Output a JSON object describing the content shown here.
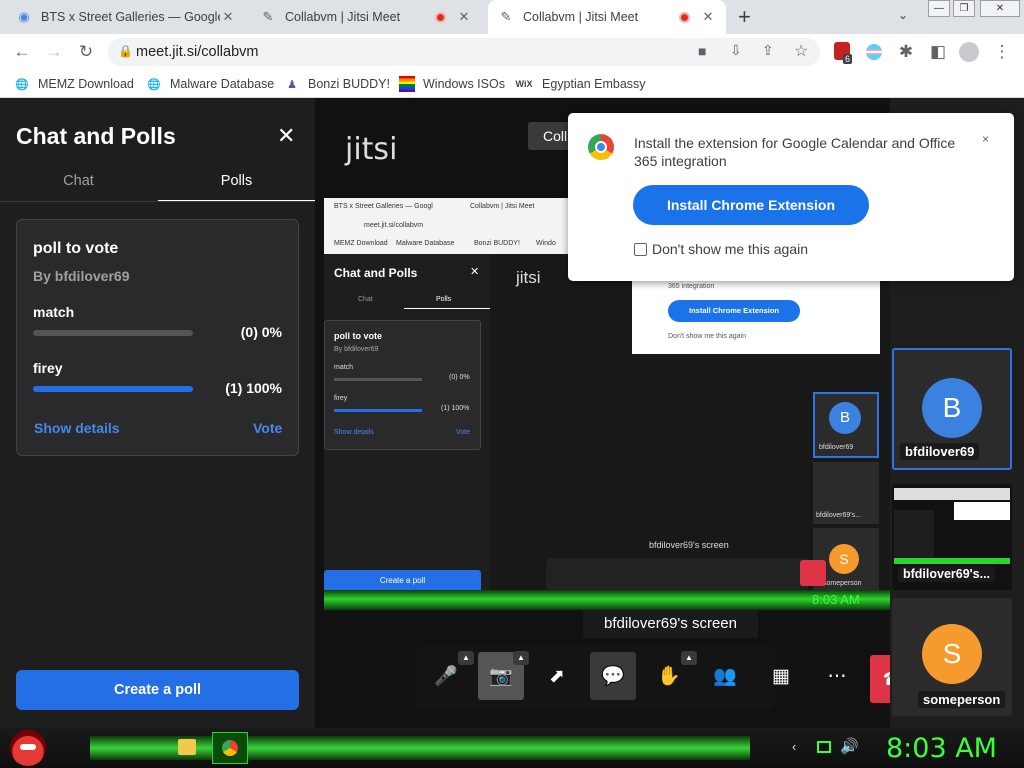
{
  "browser": {
    "tabs": [
      {
        "title": "BTS x Street Galleries — Google Arts",
        "icon": "google-arts-icon"
      },
      {
        "title": "Collabvm | Jitsi Meet",
        "icon": "jitsi-icon",
        "recording": true
      },
      {
        "title": "Collabvm | Jitsi Meet",
        "icon": "jitsi-icon",
        "recording": true,
        "active": true
      }
    ],
    "new_tab": "+",
    "url": "meet.jit.si/collabvm",
    "extension_badge": "6",
    "bookmarks": [
      {
        "label": "MEMZ Download",
        "icon": "globe-icon"
      },
      {
        "label": "Malware Database",
        "icon": "globe-icon"
      },
      {
        "label": "Bonzi BUDDY!",
        "icon": "bonzi-icon"
      },
      {
        "label": "Windows ISOs",
        "icon": "windows-flag-icon"
      },
      {
        "label": "Egyptian Embassy",
        "icon": "wix-icon",
        "icon_text": "WiX"
      }
    ]
  },
  "sidebar": {
    "title": "Chat and Polls",
    "close": "✕",
    "tabs": [
      {
        "label": "Chat",
        "selected": false
      },
      {
        "label": "Polls",
        "selected": true
      }
    ],
    "poll": {
      "question": "poll to vote",
      "author": "By bfdilover69",
      "options": [
        {
          "name": "match",
          "result": "(0) 0%",
          "fraction": 0.0
        },
        {
          "name": "firey",
          "result": "(1) 100%",
          "fraction": 1.0
        }
      ],
      "show_details": "Show details",
      "vote": "Vote"
    },
    "create_poll": "Create a poll"
  },
  "stage": {
    "logo_text": "jitsi",
    "room_label": "Coll",
    "screen_label": "bfdilover69's screen",
    "nested": {
      "tab1": "BTS x Street Galleries — Googl",
      "tab2": "Collabvm | Jitsi Meet",
      "url": "meet.jit.si/collabvm",
      "bm1": "MEMZ Download",
      "bm2": "Malware Database",
      "bm3": "Bonzi BUDDY!",
      "bm4": "Windo",
      "title": "Chat and Polls",
      "chat": "Chat",
      "polls": "Polls",
      "question": "poll to vote",
      "author": "By bfdilover69",
      "opt1": "match",
      "opt1_result": "(0) 0%",
      "opt2": "firey",
      "opt2_result": "(1) 100%",
      "show_details": "Show details",
      "vote": "Vote",
      "create_poll": "Create a poll",
      "logo": "jitsi",
      "popup_text": "365 integration",
      "popup_btn": "Install Chrome Extension",
      "popup_check": "Don't show me this again",
      "avatar": "B",
      "tile1": "bfdilover69",
      "tile2": "bfdilover69's...",
      "tile3": "someperson",
      "avatar3": "S",
      "screen_label": "bfdilover69's screen",
      "clock": "8:03 AM"
    },
    "toolbar": [
      {
        "name": "microphone-button",
        "icon": "🎤",
        "caret": true
      },
      {
        "name": "camera-off-button",
        "icon": "📷",
        "caret": true,
        "disabled": true
      },
      {
        "name": "share-screen-button",
        "icon": "⬈",
        "caret": false
      },
      {
        "name": "chat-button",
        "icon": "💬",
        "caret": false,
        "highlighted": true
      },
      {
        "name": "raise-hand-button",
        "icon": "✋",
        "caret": true
      },
      {
        "name": "participants-button",
        "icon": "👥",
        "caret": false
      },
      {
        "name": "tile-view-button",
        "icon": "▦",
        "caret": false
      },
      {
        "name": "more-actions-button",
        "icon": "⋯",
        "caret": false
      }
    ],
    "hangup_icon": "☎"
  },
  "filmstrip": {
    "tiles": [
      {
        "name": "bfdilover69",
        "avatar": "B",
        "avatar_color": "#3b82e0",
        "active": true
      },
      {
        "name": "bfdilover69's...",
        "screen_share": true
      },
      {
        "name": "someperson",
        "avatar": "S",
        "avatar_color": "#f79a2e"
      }
    ]
  },
  "popup": {
    "text": "Install the extension for Google Calendar and Office 365 integration",
    "button": "Install Chrome Extension",
    "checkbox": "Don't show me this again",
    "close": "×"
  },
  "taskbar": {
    "clock": "8:03 AM"
  },
  "colors": {
    "accent": "#246fe5",
    "hangup": "#dd3545",
    "clock": "#3cff3c"
  }
}
